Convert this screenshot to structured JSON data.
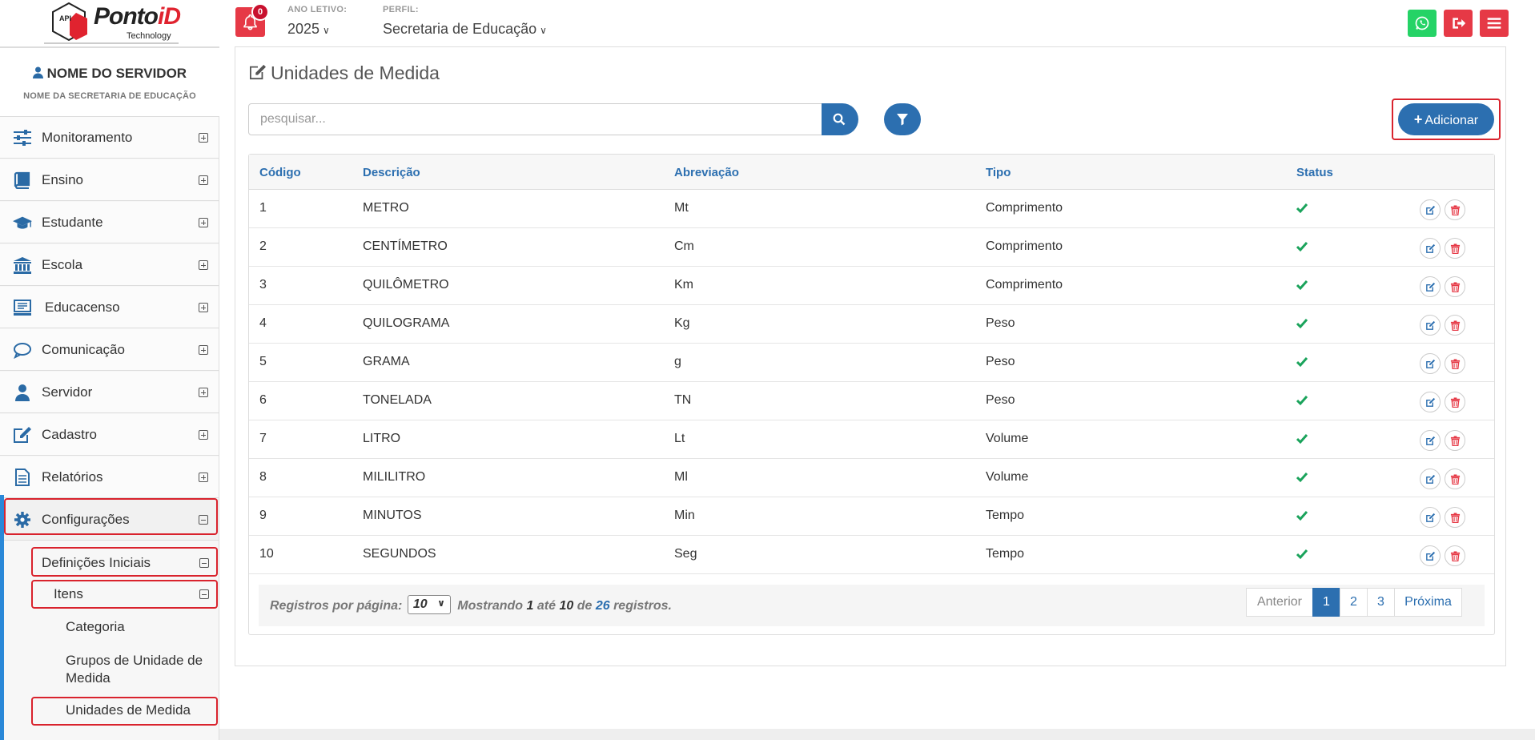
{
  "header": {
    "logo_api": "API",
    "logo_brand_main": "Ponto",
    "logo_brand_accent": "iD",
    "logo_tagline": "Technology",
    "notification_count": "0",
    "year_label": "ANO LETIVO:",
    "year_value": "2025",
    "profile_label": "PERFIL:",
    "profile_value": "Secretaria de Educação",
    "colors": {
      "whatsapp": "#25d366",
      "logout": "#e63946",
      "menu": "#e63946",
      "bell": "#e63946"
    }
  },
  "sidebar": {
    "user_name": "NOME DO SERVIDOR",
    "user_sub": "NOME DA SECRETARIA DE EDUCAÇÃO",
    "items": [
      {
        "label": "Monitoramento",
        "icon": "sliders-icon"
      },
      {
        "label": "Ensino",
        "icon": "book-icon"
      },
      {
        "label": "Estudante",
        "icon": "graduation-cap-icon"
      },
      {
        "label": "Escola",
        "icon": "institution-icon"
      },
      {
        "label": "Educacenso",
        "icon": "monitor-icon"
      },
      {
        "label": "Comunicação",
        "icon": "chat-icon"
      },
      {
        "label": "Servidor",
        "icon": "user-icon"
      },
      {
        "label": "Cadastro",
        "icon": "edit-icon"
      },
      {
        "label": "Relatórios",
        "icon": "file-icon"
      },
      {
        "label": "Configurações",
        "icon": "gear-icon"
      }
    ],
    "sub": {
      "definicoes": "Definições Iniciais",
      "itens": "Itens",
      "categoria": "Categoria",
      "grupos": "Grupos de Unidade de Medida",
      "unidades": "Unidades de Medida"
    }
  },
  "main": {
    "title": "Unidades de Medida",
    "search_placeholder": "pesquisar...",
    "add_label": "Adicionar",
    "columns": [
      "Código",
      "Descrição",
      "Abreviação",
      "Tipo",
      "Status"
    ],
    "rows": [
      {
        "codigo": "1",
        "descricao": "METRO",
        "abreviacao": "Mt",
        "tipo": "Comprimento"
      },
      {
        "codigo": "2",
        "descricao": "CENTÍMETRO",
        "abreviacao": "Cm",
        "tipo": "Comprimento"
      },
      {
        "codigo": "3",
        "descricao": "QUILÔMETRO",
        "abreviacao": "Km",
        "tipo": "Comprimento"
      },
      {
        "codigo": "4",
        "descricao": "QUILOGRAMA",
        "abreviacao": "Kg",
        "tipo": "Peso"
      },
      {
        "codigo": "5",
        "descricao": "GRAMA",
        "abreviacao": "g",
        "tipo": "Peso"
      },
      {
        "codigo": "6",
        "descricao": "TONELADA",
        "abreviacao": "TN",
        "tipo": "Peso"
      },
      {
        "codigo": "7",
        "descricao": "LITRO",
        "abreviacao": "Lt",
        "tipo": "Volume"
      },
      {
        "codigo": "8",
        "descricao": "MILILITRO",
        "abreviacao": "Ml",
        "tipo": "Volume"
      },
      {
        "codigo": "9",
        "descricao": "MINUTOS",
        "abreviacao": "Min",
        "tipo": "Tempo"
      },
      {
        "codigo": "10",
        "descricao": "SEGUNDOS",
        "abreviacao": "Seg",
        "tipo": "Tempo"
      }
    ],
    "footer": {
      "per_page_label": "Registros por página:",
      "per_page_value": "10",
      "showing": "Mostrando",
      "from": "1",
      "until": "até",
      "to": "10",
      "of": "de",
      "total": "26",
      "records": "registros."
    },
    "pagination": {
      "prev": "Anterior",
      "pages": [
        "1",
        "2",
        "3"
      ],
      "next": "Próxima"
    },
    "colors": {
      "primary": "#2c6fb0",
      "status_ok": "#1aa35b",
      "delete": "#e63946",
      "highlight": "#d9232d"
    }
  }
}
